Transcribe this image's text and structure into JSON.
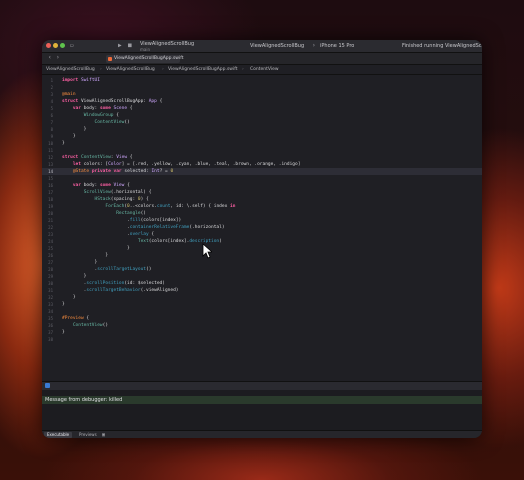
{
  "colors": {
    "keyword": "#fc5fa3",
    "type": "#d0a8ff",
    "function": "#67b7a4",
    "number": "#d0bf69",
    "attribute": "#fd8f3f",
    "console_bar": "#2a3a2c"
  },
  "titlebar": {
    "project_name": "ViewAlignedScrollBug",
    "project_branch": "main",
    "scheme": "ViewAlignedScrollBug",
    "device": "iPhone 15 Pro",
    "status": "Finished running ViewAlignedScrollBug"
  },
  "tab": {
    "label": "ViewAlignedScrollBugApp.swift"
  },
  "jumpbar": {
    "items": [
      "ViewAlignedScrollBug",
      "ViewAlignedScrollBug",
      "ViewAlignedScrollBugApp.swift",
      "ContentView"
    ]
  },
  "editor": {
    "active_line": 14,
    "lines": [
      {
        "n": "1",
        "text": "import SwiftUI"
      },
      {
        "n": "2",
        "text": ""
      },
      {
        "n": "3",
        "text": "@main"
      },
      {
        "n": "4",
        "text": "struct ViewAlignedScrollBugApp: App {"
      },
      {
        "n": "5",
        "text": "    var body: some Scene {"
      },
      {
        "n": "6",
        "text": "        WindowGroup {"
      },
      {
        "n": "7",
        "text": "            ContentView()"
      },
      {
        "n": "8",
        "text": "        }"
      },
      {
        "n": "9",
        "text": "    }"
      },
      {
        "n": "10",
        "text": "}"
      },
      {
        "n": "11",
        "text": ""
      },
      {
        "n": "12",
        "text": "struct ContentView: View {"
      },
      {
        "n": "13",
        "text": "    let colors: [Color] = [.red, .yellow, .cyan, .blue, .teal, .brown, .orange, .indigo]"
      },
      {
        "n": "14",
        "text": "    @State private var selected: Int? = 0"
      },
      {
        "n": "15",
        "text": ""
      },
      {
        "n": "16",
        "text": "    var body: some View {"
      },
      {
        "n": "17",
        "text": "        ScrollView(.horizontal) {"
      },
      {
        "n": "18",
        "text": "            HStack(spacing: 0) {"
      },
      {
        "n": "19",
        "text": "                ForEach(0..<colors.count, id: \\.self) { index in"
      },
      {
        "n": "20",
        "text": "                    Rectangle()"
      },
      {
        "n": "21",
        "text": "                        .fill(colors[index])"
      },
      {
        "n": "22",
        "text": "                        .containerRelativeFrame(.horizontal)"
      },
      {
        "n": "23",
        "text": "                        .overlay {"
      },
      {
        "n": "24",
        "text": "                            Text(colors[index].description)"
      },
      {
        "n": "25",
        "text": "                        }"
      },
      {
        "n": "26",
        "text": "                }"
      },
      {
        "n": "27",
        "text": "            }"
      },
      {
        "n": "28",
        "text": "            .scrollTargetLayout()"
      },
      {
        "n": "29",
        "text": "        }"
      },
      {
        "n": "30",
        "text": "        .scrollPosition(id: $selected)"
      },
      {
        "n": "31",
        "text": "        .scrollTargetBehavior(.viewAligned)"
      },
      {
        "n": "32",
        "text": "    }"
      },
      {
        "n": "33",
        "text": "}"
      },
      {
        "n": "34",
        "text": ""
      },
      {
        "n": "35",
        "text": "#Preview {"
      },
      {
        "n": "36",
        "text": "    ContentView()"
      },
      {
        "n": "37",
        "text": "}"
      },
      {
        "n": "38",
        "text": ""
      }
    ]
  },
  "console": {
    "message": "Message from debugger: killed"
  },
  "bottom_tabs": [
    {
      "label": "Executable",
      "active": true
    },
    {
      "label": "Previews",
      "active": false
    }
  ]
}
